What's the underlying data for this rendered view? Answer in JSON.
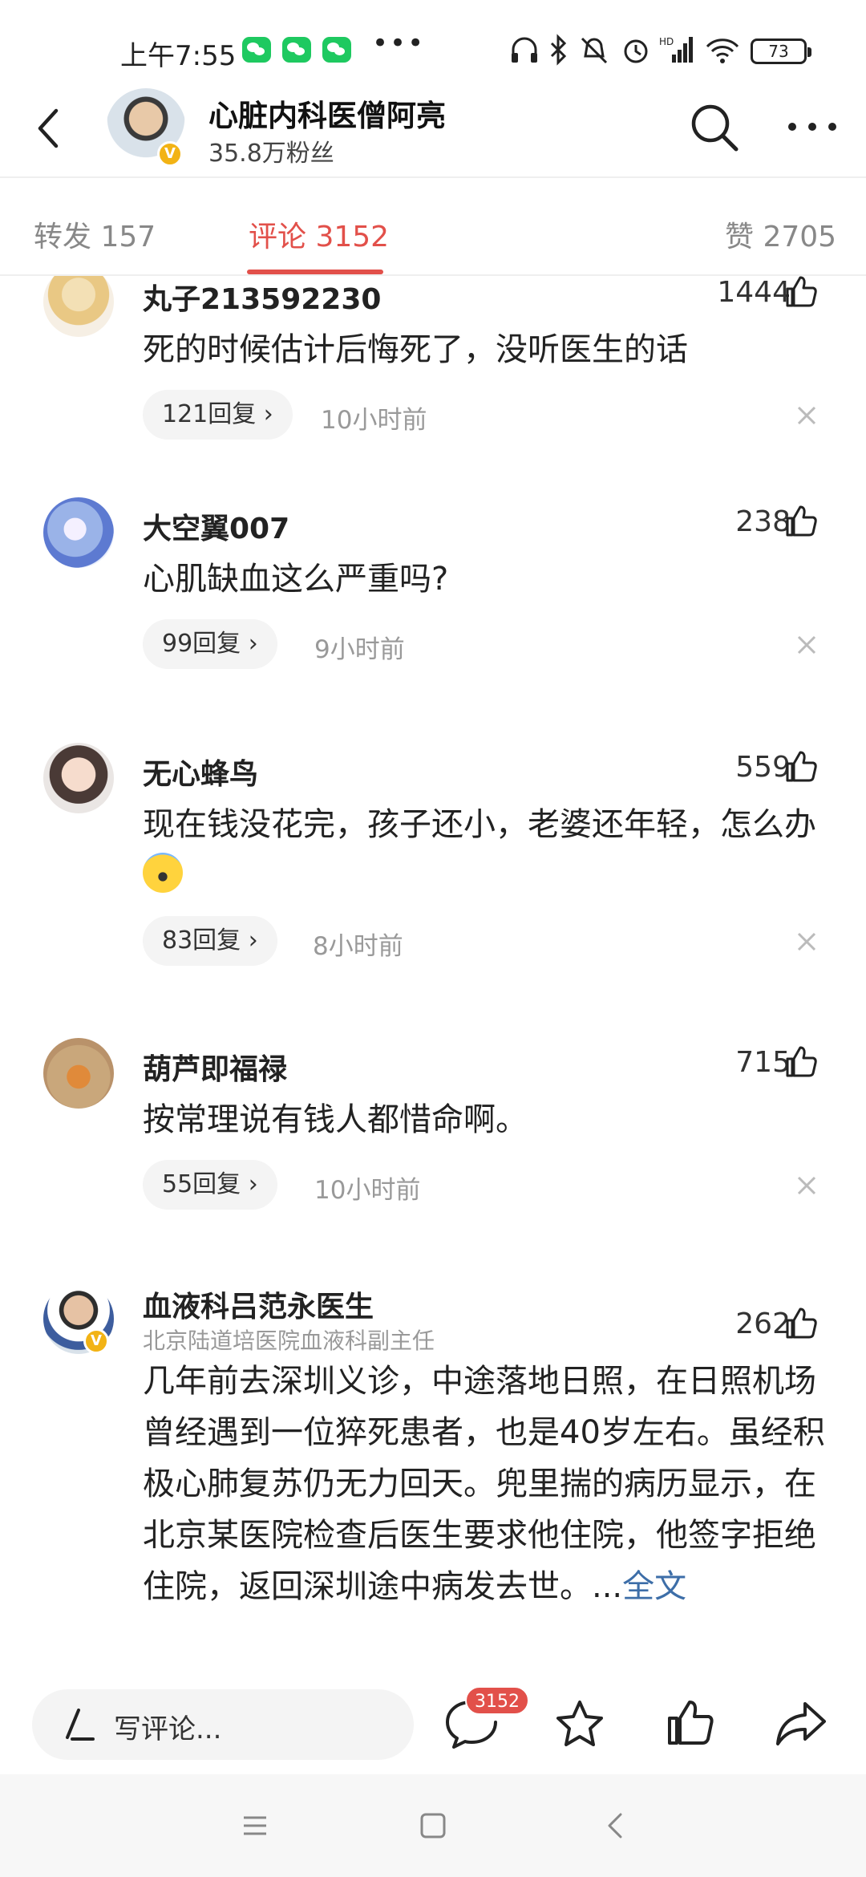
{
  "status_bar": {
    "time": "上午7:55",
    "dots": "•••",
    "battery": "73",
    "icons": [
      "wechat-icon",
      "headphones-icon",
      "bluetooth-icon",
      "mute-icon",
      "alarm-icon",
      "signal-icon",
      "wifi-icon",
      "battery-icon"
    ]
  },
  "header": {
    "author_name": "心脏内科医僧阿亮",
    "fans": "35.8万粉丝",
    "verified_mark": "V"
  },
  "tabs": [
    {
      "label": "转发 157"
    },
    {
      "label": "评论 3152"
    },
    {
      "label": "赞 2705"
    }
  ],
  "colors": {
    "accent": "#e2504a",
    "link": "#3d6ea8",
    "verified": "#f2b315"
  },
  "comments": [
    {
      "user": "丸子213592230",
      "likes": "1444",
      "text": "死的时候估计后悔死了，没听医生的话",
      "replies": "121回复",
      "time": "10小时前"
    },
    {
      "user": "大空翼007",
      "likes": "238",
      "text": "心肌缺血这么严重吗?",
      "replies": "99回复",
      "time": "9小时前"
    },
    {
      "user": "无心蜂鸟",
      "likes": "559",
      "text": "现在钱没花完，孩子还小，老婆还年轻，怎么办",
      "replies": "83回复",
      "time": "8小时前"
    },
    {
      "user": "葫芦即福禄",
      "likes": "715",
      "text": "按常理说有钱人都惜命啊。",
      "replies": "55回复",
      "time": "10小时前"
    },
    {
      "user": "血液科吕范永医生",
      "subtitle": "北京陆道培医院血液科副主任",
      "likes": "262",
      "text": "几年前去深圳义诊，中途落地日照，在日照机场曾经遇到一位猝死患者，也是40岁左右。虽经积极心肺复苏仍无力回天。兜里揣的病历显示，在北京某医院检查后医生要求他住院，他签字拒绝住院，返回深圳途中病发去世。...",
      "more": "全文"
    }
  ],
  "bottom_bar": {
    "placeholder": "写评论...",
    "comment_count": "3152"
  }
}
